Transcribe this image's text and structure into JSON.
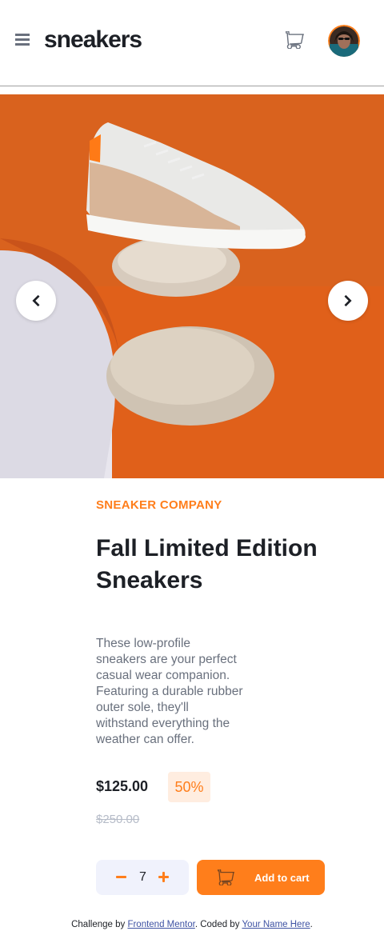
{
  "header": {
    "logo": "sneakers",
    "icons": {
      "menu": "menu-icon",
      "cart": "cart-icon",
      "avatar": "avatar"
    }
  },
  "gallery": {
    "prev_icon": "chevron-left-icon",
    "next_icon": "chevron-right-icon"
  },
  "product": {
    "company": "SNEAKER COMPANY",
    "title": "Fall Limited Edition Sneakers",
    "description": "These low-profile sneakers are your perfect casual wear companion. Featuring a durable rubber outer sole, they'll withstand everything the weather can offer.",
    "price": "$125.00",
    "discount": "50%",
    "original_price": "$250.00"
  },
  "cart_controls": {
    "quantity": "7",
    "add_label": "Add to cart"
  },
  "attribution": {
    "prefix": "Challenge by ",
    "link1": "Frontend Mentor",
    "middle": ". Coded by ",
    "link2": "Your Name Here",
    "suffix": "."
  },
  "colors": {
    "accent": "#ff7e1b",
    "accent_pale": "#ffede0",
    "text_dark": "#1d2026",
    "text_gray": "#69707d",
    "text_light": "#b6bcc8",
    "qty_bg": "#f0f2fc"
  }
}
